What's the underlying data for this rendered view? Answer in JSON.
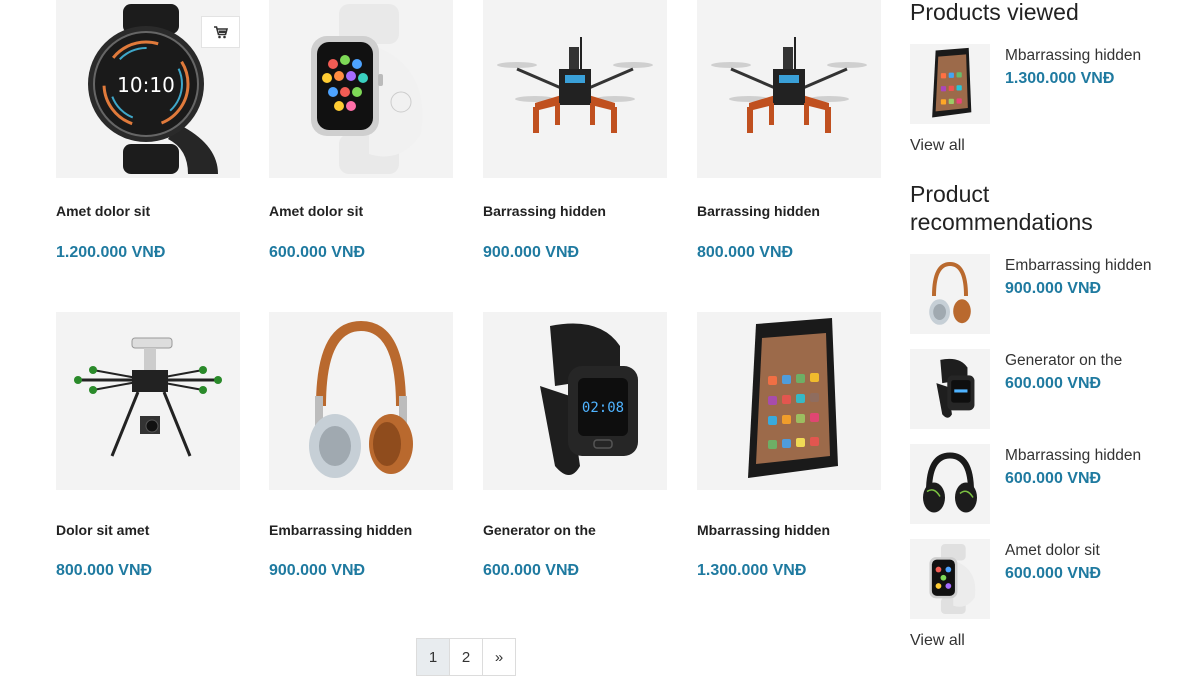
{
  "products": [
    {
      "name": "Amet dolor sit",
      "price": "1.200.000 VNĐ",
      "image": "smartwatch-round"
    },
    {
      "name": "Amet dolor sit",
      "price": "600.000 VNĐ",
      "image": "apple-watch"
    },
    {
      "name": "Barrassing hidden",
      "price": "900.000 VNĐ",
      "image": "quadcopter"
    },
    {
      "name": "Barrassing hidden",
      "price": "800.000 VNĐ",
      "image": "quadcopter"
    },
    {
      "name": "Dolor sit amet",
      "price": "800.000 VNĐ",
      "image": "hexacopter"
    },
    {
      "name": "Embarrassing hidden",
      "price": "900.000 VNĐ",
      "image": "headphones-brown"
    },
    {
      "name": "Generator on the",
      "price": "600.000 VNĐ",
      "image": "fitness-band"
    },
    {
      "name": "Mbarrassing hidden",
      "price": "1.300.000 VNĐ",
      "image": "smartphone"
    }
  ],
  "cart_icon": "cart-icon",
  "pagination": {
    "pages": [
      "1",
      "2"
    ],
    "next": "»",
    "current": "1"
  },
  "sidebar": {
    "viewed": {
      "title": "Products viewed",
      "items": [
        {
          "name": "Mbarrassing hidden",
          "price": "1.300.000 VNĐ",
          "image": "smartphone"
        }
      ],
      "view_all": "View all"
    },
    "recommendations": {
      "title": "Product recommendations",
      "items": [
        {
          "name": "Embarrassing hidden",
          "price": "900.000 VNĐ",
          "image": "headphones-brown"
        },
        {
          "name": "Generator on the",
          "price": "600.000 VNĐ",
          "image": "fitness-band"
        },
        {
          "name": "Mbarrassing hidden",
          "price": "600.000 VNĐ",
          "image": "headphones-black"
        },
        {
          "name": "Amet dolor sit",
          "price": "600.000 VNĐ",
          "image": "apple-watch"
        }
      ],
      "view_all": "View all"
    }
  },
  "colors": {
    "price": "#1f7aa0",
    "thumb_bg": "#f3f3f3"
  }
}
